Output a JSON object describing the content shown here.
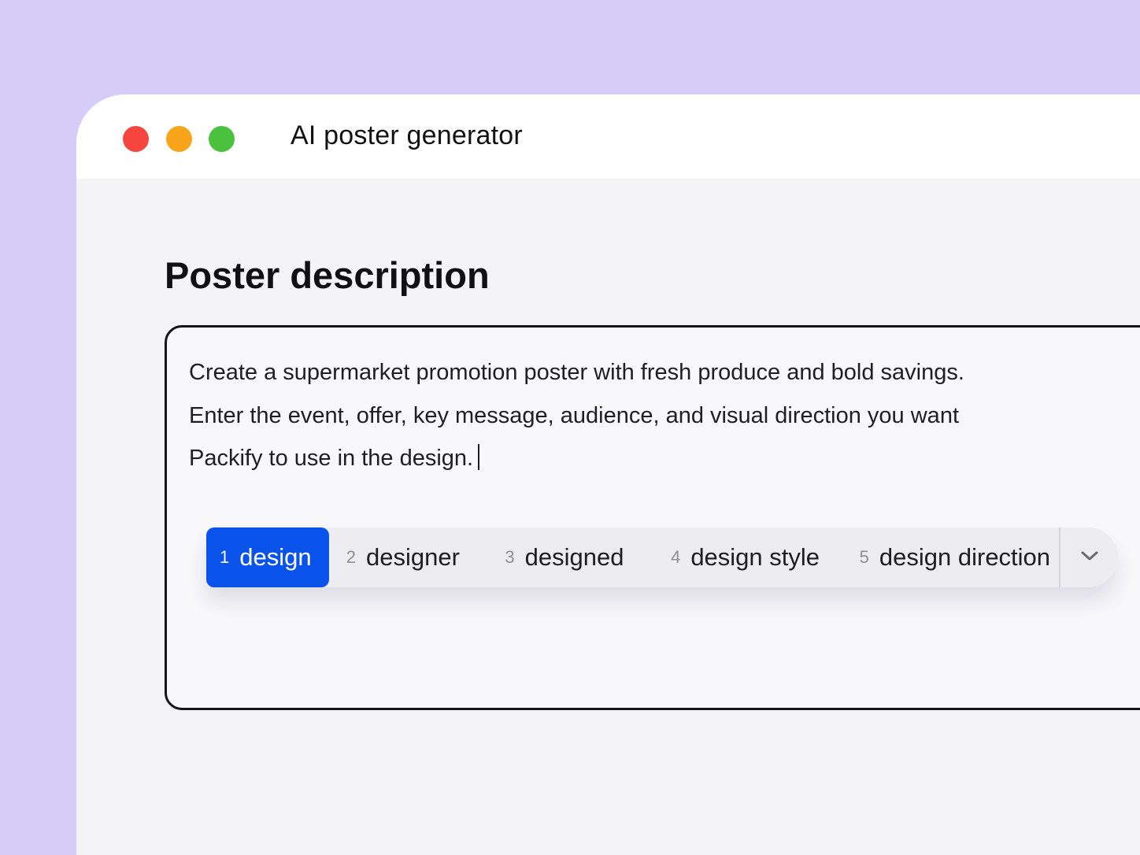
{
  "window": {
    "title": "AI poster generator",
    "controls": [
      "close",
      "minimize",
      "zoom"
    ]
  },
  "section": {
    "title": "Poster description"
  },
  "description": {
    "text": "Create a supermarket promotion poster with fresh produce and bold savings.\nEnter the event, offer, key message, audience, and visual direction you want\nPackify to use in the design."
  },
  "suggestions": [
    {
      "number": "1",
      "label": "design",
      "active": true
    },
    {
      "number": "2",
      "label": "designer",
      "active": false
    },
    {
      "number": "3",
      "label": "designed",
      "active": false
    },
    {
      "number": "4",
      "label": "design style",
      "active": false
    },
    {
      "number": "5",
      "label": "design direction",
      "active": false
    }
  ],
  "icons": {
    "expand": "chevron-down-icon"
  },
  "colors": {
    "background": "#d5ccf7",
    "active_suggestion": "#0a53ea",
    "close": "#f6453f",
    "minimize": "#f8a51b",
    "zoom": "#4ac23d"
  }
}
